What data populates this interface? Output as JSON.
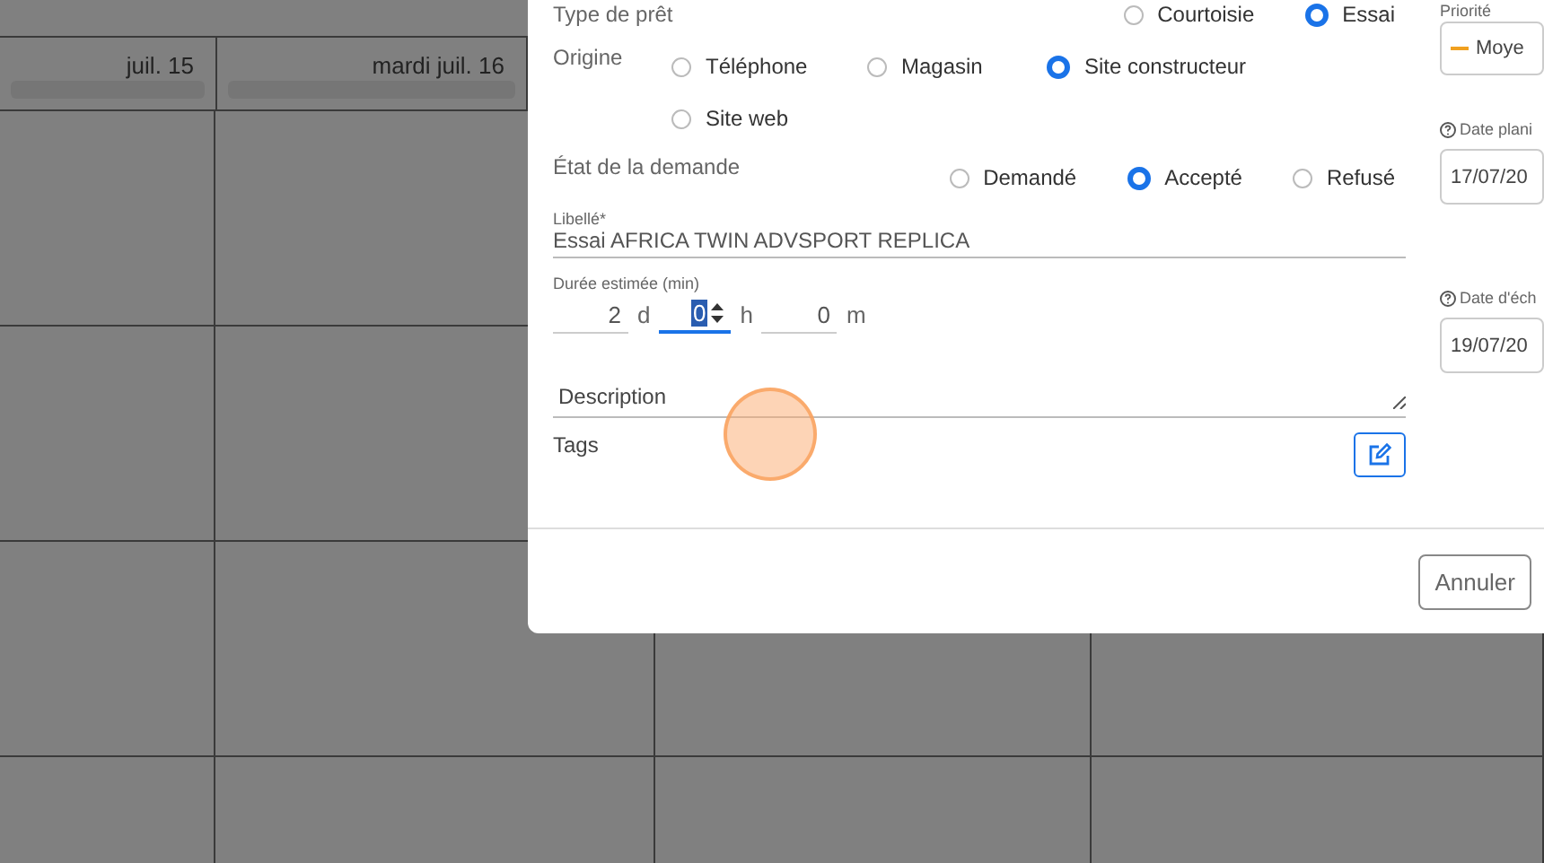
{
  "calendar": {
    "day_headers": [
      {
        "label": "juil. 15"
      },
      {
        "label": "mardi juil. 16"
      }
    ]
  },
  "dialog": {
    "loan_type": {
      "label": "Type de prêt",
      "options": [
        {
          "label": "Courtoisie",
          "selected": false
        },
        {
          "label": "Essai",
          "selected": true
        }
      ]
    },
    "origin": {
      "label": "Origine",
      "options": [
        {
          "label": "Téléphone",
          "selected": false
        },
        {
          "label": "Magasin",
          "selected": false
        },
        {
          "label": "Site constructeur",
          "selected": true
        },
        {
          "label": "Site web",
          "selected": false
        }
      ]
    },
    "request_state": {
      "label": "État de la demande",
      "options": [
        {
          "label": "Demandé",
          "selected": false
        },
        {
          "label": "Accepté",
          "selected": true
        },
        {
          "label": "Refusé",
          "selected": false
        }
      ]
    },
    "title_field": {
      "label": "Libellé*",
      "value": "Essai AFRICA TWIN ADVSPORT REPLICA"
    },
    "duration": {
      "label": "Durée estimée (min)",
      "days": "2",
      "days_unit": "d",
      "hours": "0",
      "hours_unit": "h",
      "minutes": "0",
      "minutes_unit": "m"
    },
    "description": {
      "placeholder": "Description"
    },
    "tags": {
      "label": "Tags"
    },
    "priority": {
      "label": "Priorité",
      "value": "Moye"
    },
    "planned_date": {
      "label": "Date plani",
      "value": "17/07/20"
    },
    "due_date": {
      "label": "Date d'éch",
      "value": "19/07/20"
    },
    "buttons": [
      {
        "label": "Annuler"
      }
    ]
  }
}
